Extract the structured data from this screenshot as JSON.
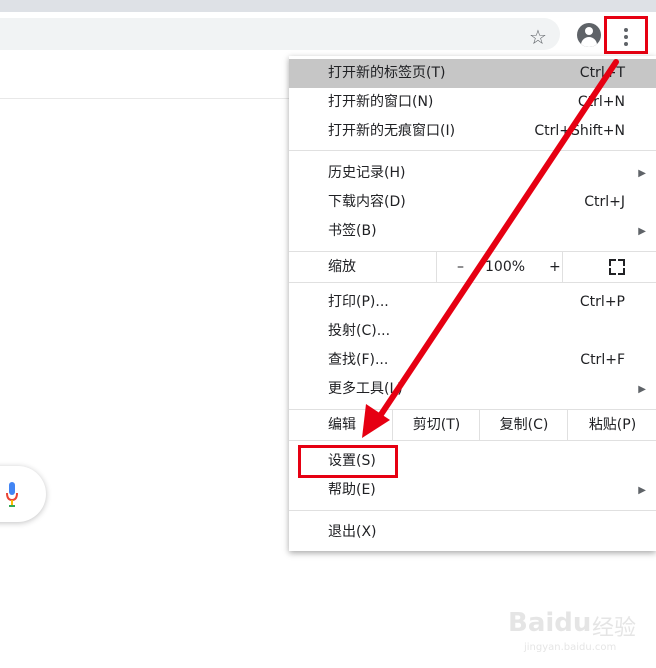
{
  "toolbar": {
    "star_icon": "star-icon",
    "profile_icon": "account-circle-icon",
    "menu_icon": "three-dot-menu-icon"
  },
  "menu": {
    "new_tab": {
      "label": "打开新的标签页(T)",
      "shortcut": "Ctrl+T"
    },
    "new_window": {
      "label": "打开新的窗口(N)",
      "shortcut": "Ctrl+N"
    },
    "new_incognito": {
      "label": "打开新的无痕窗口(I)",
      "shortcut": "Ctrl+Shift+N"
    },
    "history": {
      "label": "历史记录(H)"
    },
    "downloads": {
      "label": "下载内容(D)",
      "shortcut": "Ctrl+J"
    },
    "bookmarks": {
      "label": "书签(B)"
    },
    "zoom": {
      "label": "缩放",
      "minus": "–",
      "value": "100%",
      "plus": "+"
    },
    "print": {
      "label": "打印(P)...",
      "shortcut": "Ctrl+P"
    },
    "cast": {
      "label": "投射(C)..."
    },
    "find": {
      "label": "查找(F)...",
      "shortcut": "Ctrl+F"
    },
    "more_tools": {
      "label": "更多工具(L)"
    },
    "edit": {
      "label": "编辑",
      "cut": "剪切(T)",
      "copy": "复制(C)",
      "paste": "粘贴(P)"
    },
    "settings": {
      "label": "设置(S)"
    },
    "help": {
      "label": "帮助(E)"
    },
    "exit": {
      "label": "退出(X)"
    }
  },
  "watermark": {
    "logo": "Baidu",
    "cn": "经验",
    "url": "jingyan.baidu.com"
  },
  "colors": {
    "annotation_red": "#e60012",
    "highlight_gray": "#c6c6c6"
  }
}
